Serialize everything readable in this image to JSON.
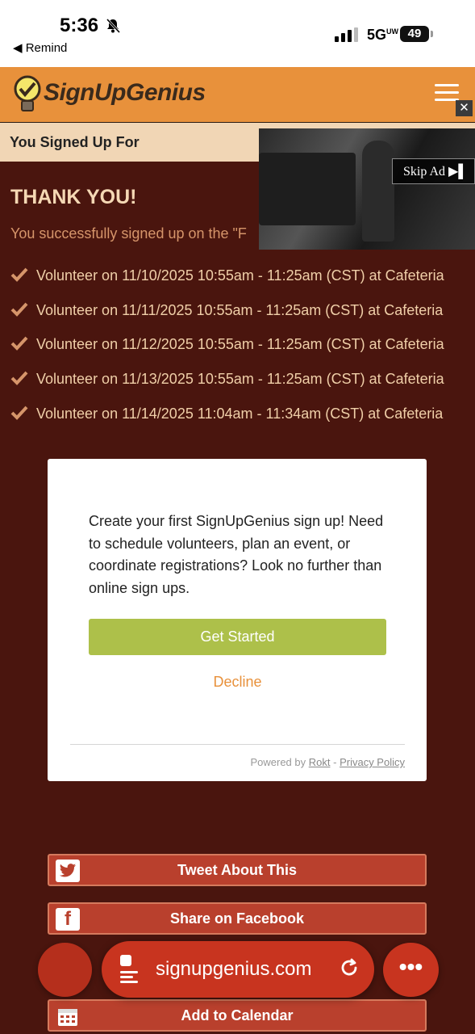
{
  "status_bar": {
    "time": "5:36",
    "back_app": "◀ Remind",
    "network": "5G",
    "network_sup": "UW",
    "battery": "49"
  },
  "header": {
    "brand": "SignUpGenius",
    "ad_close": "✕"
  },
  "signed_bar": {
    "title": "You Signed Up For"
  },
  "video_ad": {
    "skip_label": "Skip Ad"
  },
  "main": {
    "thanks": "THANK YOU!",
    "success_text": "You successfully signed up on the \"F",
    "items": [
      "Volunteer on 11/10/2025 10:55am - 11:25am (CST) at Cafeteria",
      "Volunteer on 11/11/2025 10:55am - 11:25am (CST) at Cafeteria",
      "Volunteer on 11/12/2025 10:55am - 11:25am (CST) at Cafeteria",
      "Volunteer on 11/13/2025 10:55am - 11:25am (CST) at Cafeteria",
      "Volunteer on 11/14/2025 11:04am - 11:34am (CST) at Cafeteria"
    ]
  },
  "modal": {
    "text": "Create your first SignUpGenius sign up! Need to schedule volunteers, plan an event, or coordinate registrations? Look no further than online sign ups.",
    "get_started": "Get Started",
    "decline": "Decline",
    "powered_by": "Powered by",
    "rokt": "Rokt",
    "separator": "-",
    "privacy": "Privacy Policy"
  },
  "share": {
    "tweet": "Tweet About This",
    "facebook": "Share on Facebook",
    "calendar": "Add to Calendar"
  },
  "browser": {
    "url": "signupgenius.com",
    "more": "•••"
  },
  "colors": {
    "brand_orange": "#e8913b",
    "background": "#4a150e",
    "button_green": "#adc04a",
    "share_red": "#b9402d"
  }
}
